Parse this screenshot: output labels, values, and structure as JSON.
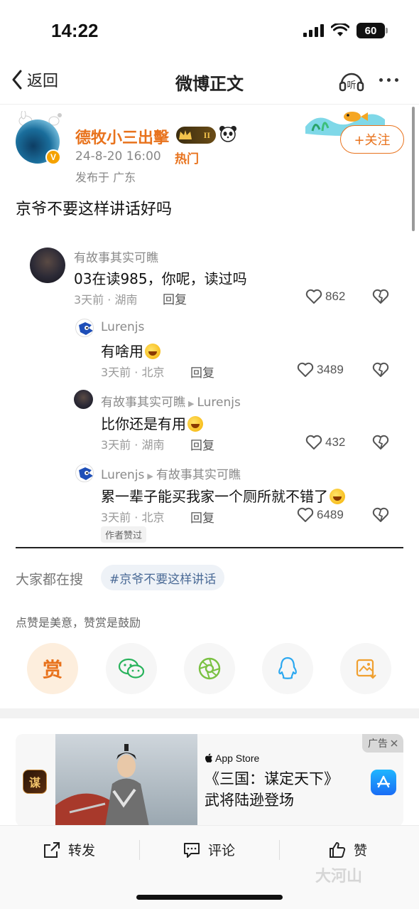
{
  "status_bar": {
    "time": "14:22",
    "battery": "60"
  },
  "nav": {
    "back_label": "返回",
    "title": "微博正文",
    "listen_label": "听"
  },
  "post": {
    "author": "德牧小三出擊",
    "level": "II",
    "verified_mark": "V",
    "time": "24-8-20 16:00",
    "hot_tag": "热门",
    "location": "发布于 广东",
    "follow_label": "+关注",
    "text": "京爷不要这样讲话好吗"
  },
  "comments": [
    {
      "user": "有故事其实可瞧",
      "reply_to": "",
      "text": "03在读985，你呢，读过吗",
      "emoji": false,
      "meta": "3天前 · 湖南",
      "reply_label": "回复",
      "likes": "862"
    },
    {
      "user": "Lurenjs",
      "reply_to": "",
      "text": "有啥用",
      "emoji": true,
      "meta": "3天前 · 北京",
      "reply_label": "回复",
      "likes": "3489"
    },
    {
      "user": "有故事其实可瞧",
      "reply_to": "Lurenjs",
      "text": "比你还是有用",
      "emoji": true,
      "meta": "3天前 · 湖南",
      "reply_label": "回复",
      "likes": "432"
    },
    {
      "user": "Lurenjs",
      "reply_to": "有故事其实可瞧",
      "text": "累一辈子能买我家一个厕所就不错了",
      "emoji": true,
      "meta": "3天前 · 北京",
      "reply_label": "回复",
      "likes": "6489",
      "badge": "作者赞过"
    }
  ],
  "search": {
    "label": "大家都在搜",
    "tag": "#京爷不要这样讲话"
  },
  "reward_tip": "点赞是美意，赞赏是鼓励",
  "share": {
    "reward_char": "赏",
    "icons": [
      "reward-icon",
      "wechat-icon",
      "moments-icon",
      "qq-icon",
      "save-image-icon"
    ]
  },
  "ad": {
    "app_icon_char": "谋",
    "store": "App Store",
    "title_line1": "《三国：谋定天下》",
    "title_line2": "武将陆逊登场",
    "tag": "广告"
  },
  "bottom_bar": {
    "repost": "转发",
    "comment": "评论",
    "like": "赞"
  },
  "watermark": "大河山",
  "colors": {
    "accent": "#e8721c",
    "link": "#4a6a96",
    "text": "#111111",
    "muted": "#8a8a8a"
  }
}
